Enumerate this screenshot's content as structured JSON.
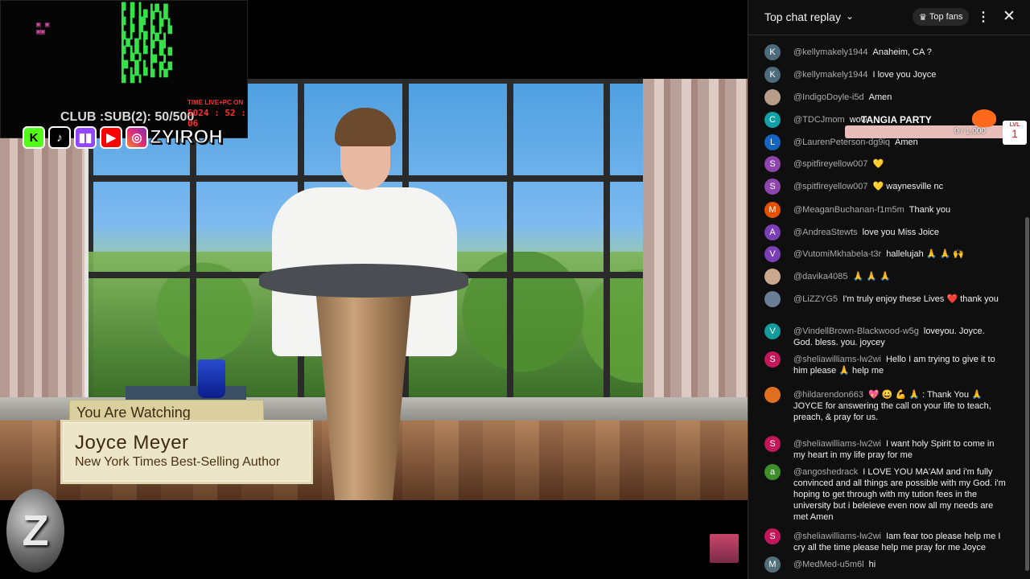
{
  "overlay": {
    "sub_count": "CLUB :SUB(2): 50/500",
    "live_label": "TIME LIVE+PC ON",
    "live_clock": "5024 : 52 : 06",
    "social_k": "K",
    "social_tiktok": "♪",
    "social_twitch": "▮▮",
    "social_youtube": "▶",
    "social_instagram": "◎",
    "handle": "ZYIROH",
    "logo": "Z"
  },
  "lower_third": {
    "tab": "You Are Watching",
    "name": "Joyce Meyer",
    "title": "New York Times Best-Selling Author"
  },
  "chat": {
    "header_title": "Top chat replay",
    "header_chevron": "⌄",
    "top_fans_label": "Top fans",
    "kebab": "⋮",
    "close": "✕",
    "party": {
      "title": "TANGIA PARTY",
      "progress": "0 / 1,000",
      "lvl_label": "LVL",
      "lvl_value": "1"
    },
    "messages": [
      {
        "initial": "K",
        "color": "#4d6b7a",
        "author": "@kellymakely1944",
        "text": "Anaheim, CA ?"
      },
      {
        "initial": "K",
        "color": "#4d6b7a",
        "author": "@kellymakely1944",
        "text": "I love you Joyce"
      },
      {
        "initial": "",
        "color": "#b89d8a",
        "author": "@IndigoDoyle-i5d",
        "text": "Amen"
      },
      {
        "initial": "C",
        "color": "#129fa6",
        "author": "@TDCJmom",
        "text": "wow"
      },
      {
        "initial": "L",
        "color": "#1565c0",
        "author": "@LaurenPeterson-dg9iq",
        "text": "Amen"
      },
      {
        "initial": "S",
        "color": "#8e44ad",
        "author": "@spitfireyellow007",
        "text": "💛"
      },
      {
        "initial": "S",
        "color": "#8e44ad",
        "author": "@spitfireyellow007",
        "text": "💛 waynesville nc"
      },
      {
        "initial": "M",
        "color": "#e65100",
        "author": "@MeaganBuchanan-f1m5m",
        "text": "Thank you"
      },
      {
        "initial": "A",
        "color": "#7b3fb5",
        "author": "@AndreaStewts",
        "text": "love you Miss Joice"
      },
      {
        "initial": "V",
        "color": "#7b3fb5",
        "author": "@VutomiMkhabela-t3r",
        "text": "hallelujah 🙏 🙏 🙌"
      },
      {
        "initial": "",
        "color": "#c9a88e",
        "author": "@davika4085",
        "text": "🙏 🙏 🙏"
      },
      {
        "initial": "",
        "color": "#6a7f95",
        "author": "@LiZZYG5",
        "text": "I'm truly enjoy these Lives ❤️ thank you"
      },
      {
        "initial": "V",
        "color": "#139b9b",
        "author": "@VindellBrown-Blackwood-w5g",
        "text": "loveyou. Joyce. God. bless. you. joycey"
      },
      {
        "initial": "S",
        "color": "#c2185b",
        "author": "@sheliawilliams-lw2wi",
        "text": "Hello I am trying to give it to him please 🙏 help me"
      },
      {
        "initial": "",
        "color": "#e07020",
        "author": "@hildarendon663",
        "text": "💖 😀 💪 🙏 : Thank You 🙏 JOYCE for answering the call on your life to teach, preach, & pray for us."
      },
      {
        "initial": "S",
        "color": "#c2185b",
        "author": "@sheliawilliams-lw2wi",
        "text": "I want holy Spirit to come in my heart in my life pray for me"
      },
      {
        "initial": "a",
        "color": "#3e8e2e",
        "author": "@angoshedrack",
        "text": "I LOVE YOU MA'AM and i'm fully convinced and all things are possible with my God. i'm hoping to get through with my tution fees in the university but i beleieve even now all my needs are met Amen"
      },
      {
        "initial": "S",
        "color": "#c2185b",
        "author": "@sheliawilliams-lw2wi",
        "text": "Iam fear too please help me I cry all the time please help me pray for me Joyce"
      },
      {
        "initial": "M",
        "color": "#546e7a",
        "author": "@MedMed-u5m6l",
        "text": "hi"
      }
    ]
  }
}
